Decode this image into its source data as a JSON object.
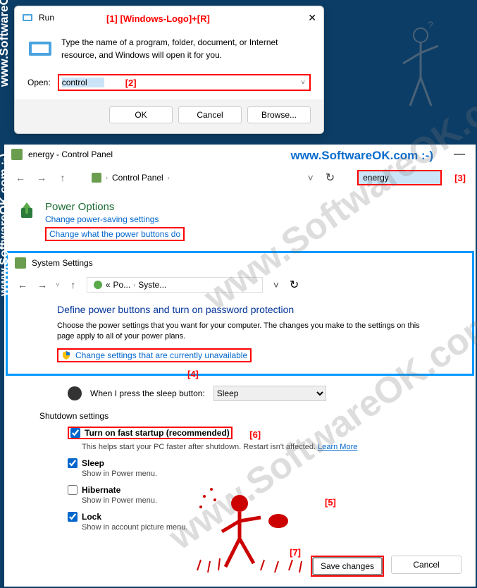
{
  "run": {
    "title": "Run",
    "desc": "Type the name of a program, folder, document, or Internet resource, and Windows will open it for you.",
    "open_label": "Open:",
    "open_value": "control",
    "ok": "OK",
    "cancel": "Cancel",
    "browse": "Browse..."
  },
  "annotations": {
    "a1": "[1]   [Windows-Logo]+[R]",
    "a2": "[2]",
    "a3": "[3]",
    "a4": "[4]",
    "a5": "[5]",
    "a6": "[6]",
    "a7": "[7]"
  },
  "cp": {
    "title": "energy - Control Panel",
    "bc1": "Control Panel",
    "search": "energy",
    "power_title": "Power Options",
    "power_sub": "Change power-saving settings",
    "power_link": "Change what the power buttons do"
  },
  "sys": {
    "title": "System Settings",
    "bc1": "Po...",
    "bc2": "Syste...",
    "heading": "Define power buttons and turn on password protection",
    "desc": "Choose the power settings that you want for your computer. The changes you make to the settings on this page apply to all of your power plans.",
    "change_link": "Change settings that are currently unavailable"
  },
  "shutdown": {
    "sleep_btn_label": "When I press the sleep button:",
    "sleep_value": "Sleep",
    "section_title": "Shutdown settings",
    "fast_startup": "Turn on fast startup (recommended)",
    "fast_startup_desc": "This helps start your PC faster after shutdown. Restart isn't affected. ",
    "learn_more": "Learn More",
    "sleep": "Sleep",
    "sleep_desc": "Show in Power menu.",
    "hibernate": "Hibernate",
    "hibernate_desc": "Show in Power menu.",
    "lock": "Lock",
    "lock_desc": "Show in account picture menu.",
    "save": "Save changes",
    "cancel": "Cancel"
  },
  "watermark": "www.SoftwareOK.com  :-)"
}
